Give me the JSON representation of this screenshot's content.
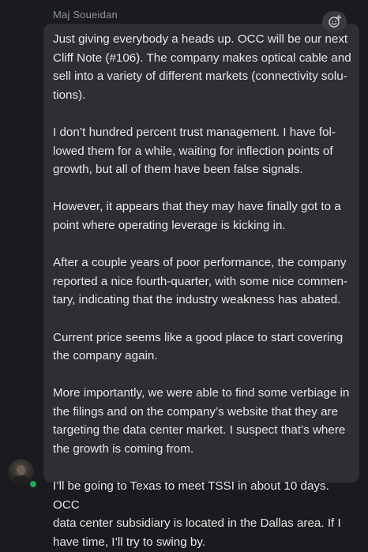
{
  "message": {
    "sender": "Maj Soueidan",
    "paragraphs": [
      "Just giving everybody a heads up. OCC will be our next\nCliff Note (#106). The company makes optical cable and\nsell into a variety of different markets (connectivity solu-\ntions).",
      "I don’t hundred percent trust management. I have fol-\nlowed them for a while, waiting for inflection points of\ngrowth, but all of them have been false signals.",
      "However, it appears that they may have finally got to a\npoint where operating leverage is kicking in.",
      "After a couple years of poor performance, the company\nreported a nice fourth-quarter, with some nice commen-\ntary, indicating that the industry weakness has abated.",
      "Current price seems like a good place to start covering\nthe company again.",
      "More importantly, we were able to find some verbiage in\nthe filings and on the company’s website that they are\ntargeting the data center market. I suspect that’s where\nthe growth is coming from.",
      "I’ll be going to Texas to meet TSSI in about 10 days. OCC\ndata center subsidiary is located in the Dallas area. If I\nhave time, I’ll try to swing by."
    ]
  },
  "icons": {
    "reaction": "add-reaction-icon",
    "avatar": "user-avatar"
  },
  "colors": {
    "background": "#1a1b1e",
    "bubble": "#2e2f33",
    "text": "#e6e6e6",
    "sender": "#8e9297",
    "presence": "#23a55a"
  }
}
